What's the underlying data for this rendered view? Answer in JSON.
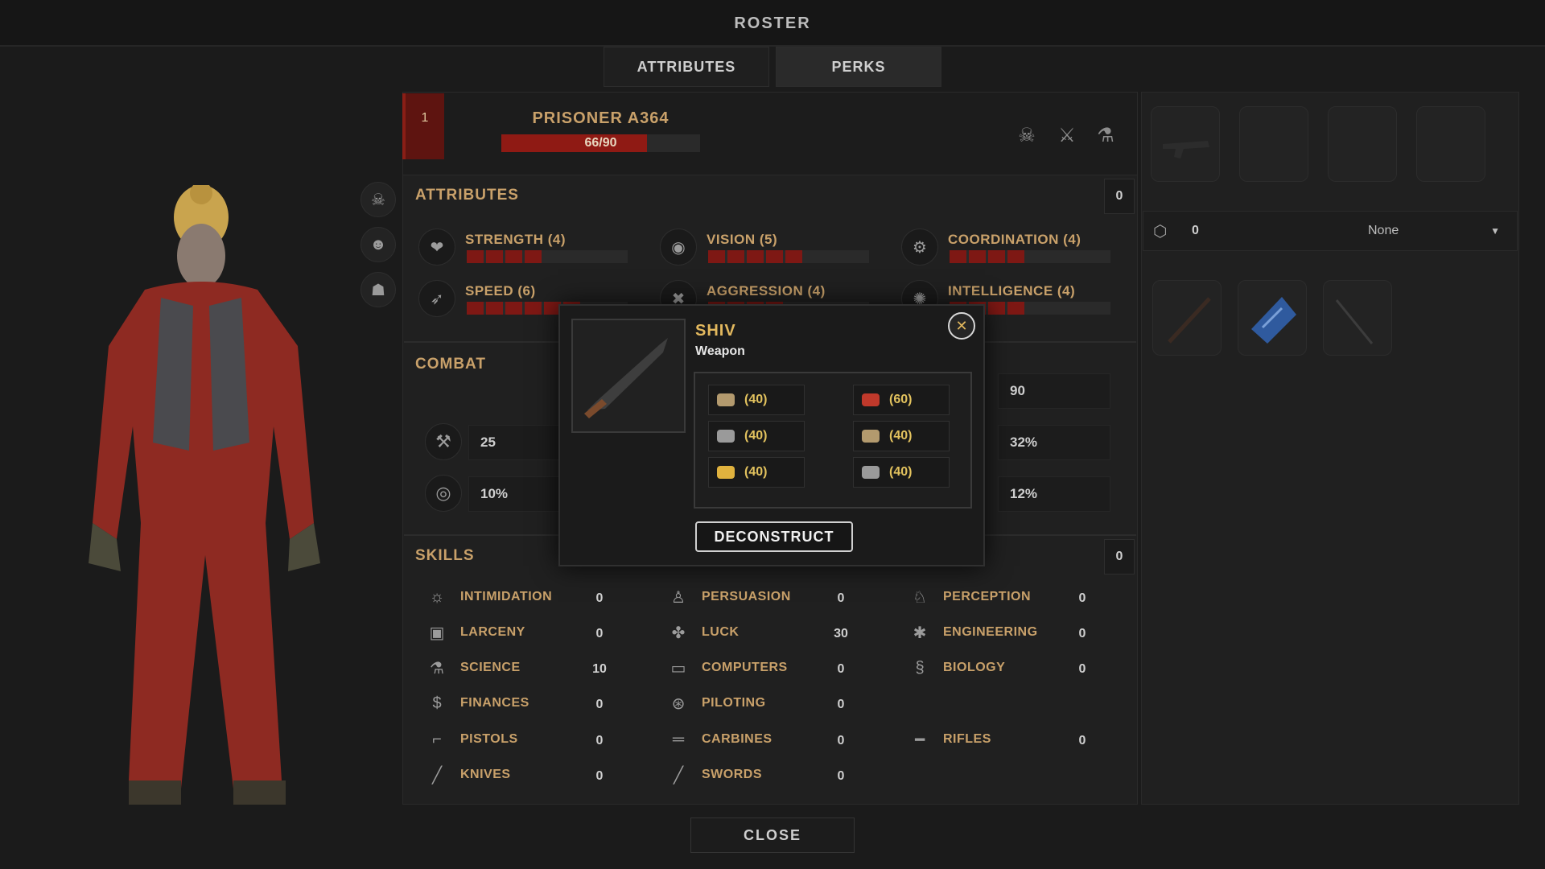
{
  "window": {
    "title": "ROSTER"
  },
  "tabs": [
    {
      "label": "ATTRIBUTES"
    },
    {
      "label": "PERKS"
    }
  ],
  "prisoner": {
    "rank": "1",
    "name": "PRISONER A364",
    "health_text": "66/90",
    "health_fraction": 0.733
  },
  "attributes": {
    "title": "ATTRIBUTES",
    "points": "0",
    "items": [
      {
        "label": "STRENGTH (4)",
        "level": 4,
        "icon": "heart-fist-icon"
      },
      {
        "label": "VISION (5)",
        "level": 5,
        "icon": "eye-icon"
      },
      {
        "label": "COORDINATION (4)",
        "level": 4,
        "icon": "coordination-icon"
      },
      {
        "label": "SPEED (6)",
        "level": 6,
        "icon": "wing-icon"
      },
      {
        "label": "AGGRESSION (4)",
        "level": 4,
        "icon": "aggression-icon"
      },
      {
        "label": "INTELLIGENCE (4)",
        "level": 4,
        "icon": "brain-icon"
      }
    ]
  },
  "combat": {
    "title": "COMBAT",
    "values": [
      "25",
      "10%",
      "90",
      "32%",
      "12%"
    ]
  },
  "skills": {
    "title": "SKILLS",
    "points": "0",
    "columns": [
      [
        {
          "label": "INTIMIDATION",
          "value": "0"
        },
        {
          "label": "LARCENY",
          "value": "0"
        },
        {
          "label": "SCIENCE",
          "value": "10"
        },
        {
          "label": "FINANCES",
          "value": "0"
        },
        {
          "label": "PISTOLS",
          "value": "0"
        },
        {
          "label": "KNIVES",
          "value": "0"
        }
      ],
      [
        {
          "label": "PERSUASION",
          "value": "0"
        },
        {
          "label": "LUCK",
          "value": "30"
        },
        {
          "label": "COMPUTERS",
          "value": "0"
        },
        {
          "label": "PILOTING",
          "value": "0"
        },
        {
          "label": "CARBINES",
          "value": "0"
        },
        {
          "label": "SWORDS",
          "value": "0"
        }
      ],
      [
        {
          "label": "PERCEPTION",
          "value": "0"
        },
        {
          "label": "ENGINEERING",
          "value": "0"
        },
        {
          "label": "BIOLOGY",
          "value": "0"
        },
        {
          "label": "RIFLES",
          "value": "0"
        }
      ]
    ]
  },
  "equipment": {
    "count": "0",
    "dropdown_selected": "None"
  },
  "modal": {
    "item_name": "SHIV",
    "item_type": "Weapon",
    "resources": [
      {
        "amount": "(40)",
        "color": "#b39a6e"
      },
      {
        "amount": "(60)",
        "color": "#c0392b"
      },
      {
        "amount": "(40)",
        "color": "#9a9a9a"
      },
      {
        "amount": "(40)",
        "color": "#b39a6e"
      },
      {
        "amount": "(40)",
        "color": "#e0b23e"
      },
      {
        "amount": "(40)",
        "color": "#9a9a9a"
      }
    ],
    "action_label": "DECONSTRUCT",
    "close_label": "✕"
  },
  "footer": {
    "close_label": "CLOSE"
  },
  "colors": {
    "accent": "#c9a16a",
    "health": "#8f1a14",
    "modal_title": "#e2b85e"
  }
}
